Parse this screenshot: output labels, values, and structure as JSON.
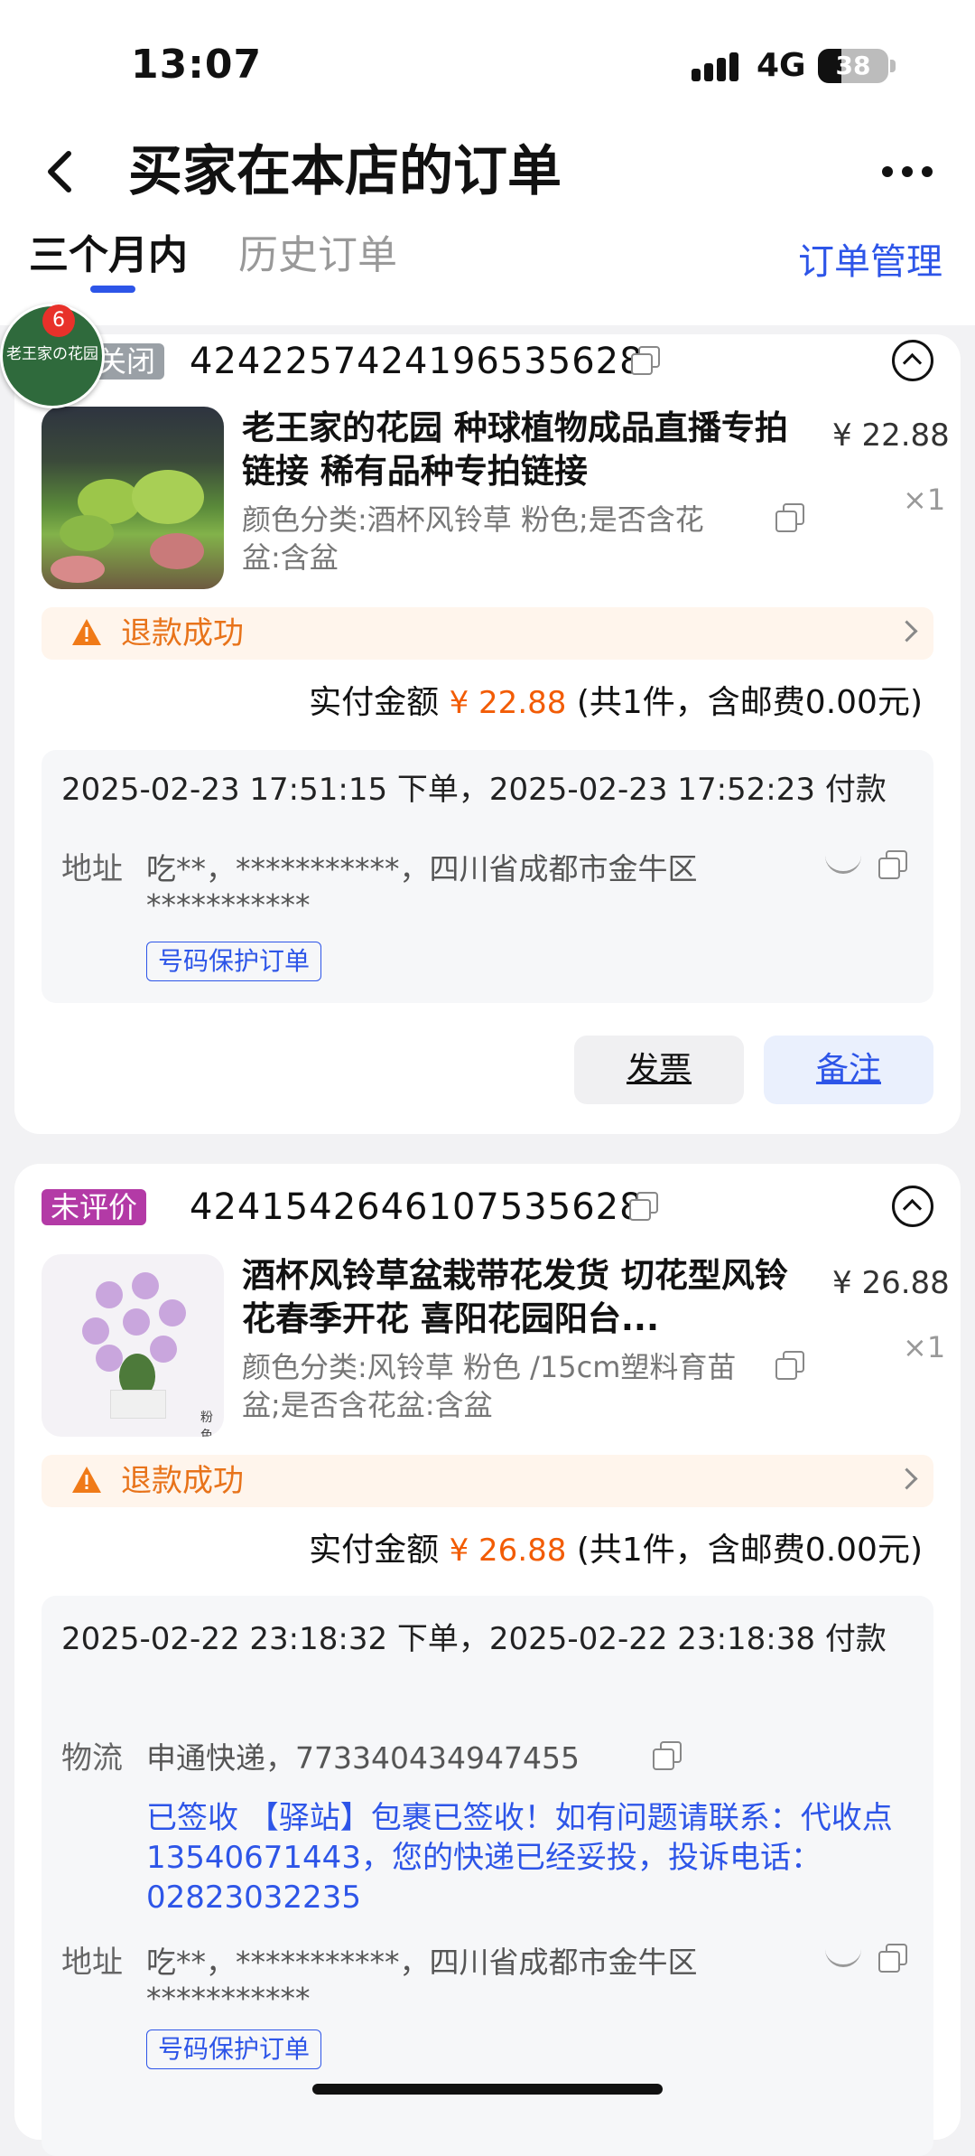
{
  "status_bar": {
    "time": "13:07",
    "network": "4G",
    "battery": "38"
  },
  "header": {
    "title": "买家在本店的订单"
  },
  "tabs": [
    {
      "label": "三个月内"
    },
    {
      "label": "历史订单"
    }
  ],
  "order_management": "订单管理",
  "floating_shop": {
    "name": "老王家の花园",
    "badge": "6"
  },
  "orders": [
    {
      "status": "关闭",
      "order_no": "4242257424196535628",
      "title": "老王家的花园 种球植物成品直播专拍链接 稀有品种专拍链接",
      "spec": "颜色分类:酒杯风铃草 粉色;是否含花盆:含盆",
      "price": "¥ 22.88",
      "qty": "×1",
      "refund": "退款成功",
      "pay_label": "实付金额",
      "pay_amount": "¥ 22.88",
      "pay_note": "(共1件，含邮费0.00元)",
      "time_line": "2025-02-23 17:51:15 下单，2025-02-23 17:52:23 付款",
      "address_label": "地址",
      "address": "吃**，***********，四川省成都市金牛区***********",
      "protect": "号码保护订单",
      "actions": {
        "invoice": "发票",
        "remark": "备注"
      }
    },
    {
      "status": "未评价",
      "order_no": "4241542646107535628",
      "title": "酒杯风铃草盆栽带花发货 切花型风铃花春季开花 喜阳花园阳台...",
      "spec": "颜色分类:风铃草 粉色 /15cm塑料育苗盆;是否含花盆:含盆",
      "image_tag": "粉色",
      "price": "¥ 26.88",
      "qty": "×1",
      "refund": "退款成功",
      "pay_label": "实付金额",
      "pay_amount": "¥ 26.88",
      "pay_note": "(共1件，含邮费0.00元)",
      "time_line": "2025-02-22 23:18:32 下单，2025-02-22 23:18:38 付款",
      "logistics_label": "物流",
      "logistics": "申通快递，773340434947455",
      "logistics_detail": "已签收 【驿站】包裹已签收！如有问题请联系：代收点13540671443，您的快递已经妥投，投诉电话：02823032235",
      "address_label": "地址",
      "address": "吃**，***********，四川省成都市金牛区***********",
      "protect": "号码保护订单"
    }
  ]
}
